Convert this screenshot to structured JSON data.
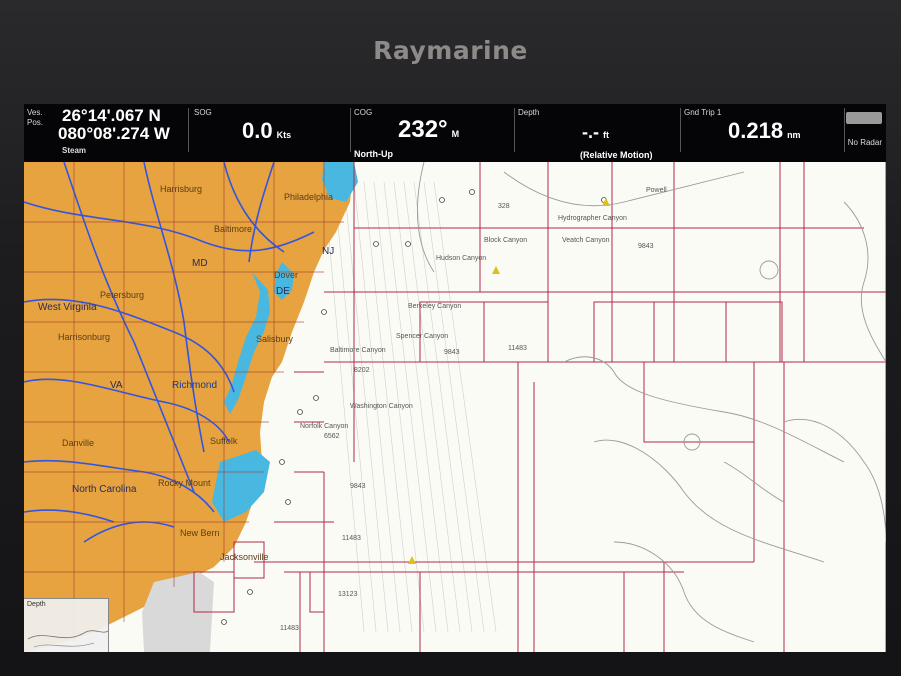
{
  "device": {
    "brand": "Raymarine"
  },
  "databar": {
    "vessel_label_1": "Ves.",
    "vessel_label_2": "Pos.",
    "latitude": "26°14'.067 N",
    "longitude": "080°08'.274 W",
    "position_mode": "Steam",
    "sog": {
      "label": "SOG",
      "value": "0.0",
      "unit": "Kts"
    },
    "cog": {
      "label": "COG",
      "value": "232°",
      "unit": "M"
    },
    "orientation": "North-Up",
    "depth": {
      "label": "Depth",
      "value": "-.-",
      "unit": "ft"
    },
    "motion_mode": "(Relative Motion)",
    "gnd_trip": {
      "label": "Gnd Trip 1",
      "value": "0.218",
      "unit": "nm"
    },
    "radar_status": "No Radar"
  },
  "chart": {
    "state_labels": [
      "MD",
      "NJ",
      "DE",
      "VA",
      "West Virginia",
      "North Carolina"
    ],
    "city_labels": [
      "Harrisburg",
      "Petersburg",
      "Harrisonburg",
      "Richmond",
      "Suffolk",
      "Danville",
      "Rocky Mount",
      "New Bern",
      "Jacksonville",
      "Salisbury",
      "Dover",
      "Philadelphia",
      "Baltimore"
    ],
    "canyon_labels": [
      "Hudson Canyon",
      "Block Canyon",
      "Veatch Canyon",
      "Hydrographer Canyon",
      "Berkeley Canyon",
      "Spencer Canyon",
      "Baltimore Canyon",
      "Washington Canyon",
      "Norfolk Canyon",
      "Powell"
    ],
    "depth_soundings": [
      "328",
      "9843",
      "11483",
      "8202",
      "6562",
      "9843",
      "11483",
      "13123",
      "11483",
      "9843"
    ],
    "inset_label": "Depth",
    "colors": {
      "land": "#e7a33f",
      "water": "#ffffff",
      "shallow": "#49b8e0",
      "roads": "#3355e0",
      "grid": "#b02a48",
      "contours": "#9a9a9a"
    }
  }
}
